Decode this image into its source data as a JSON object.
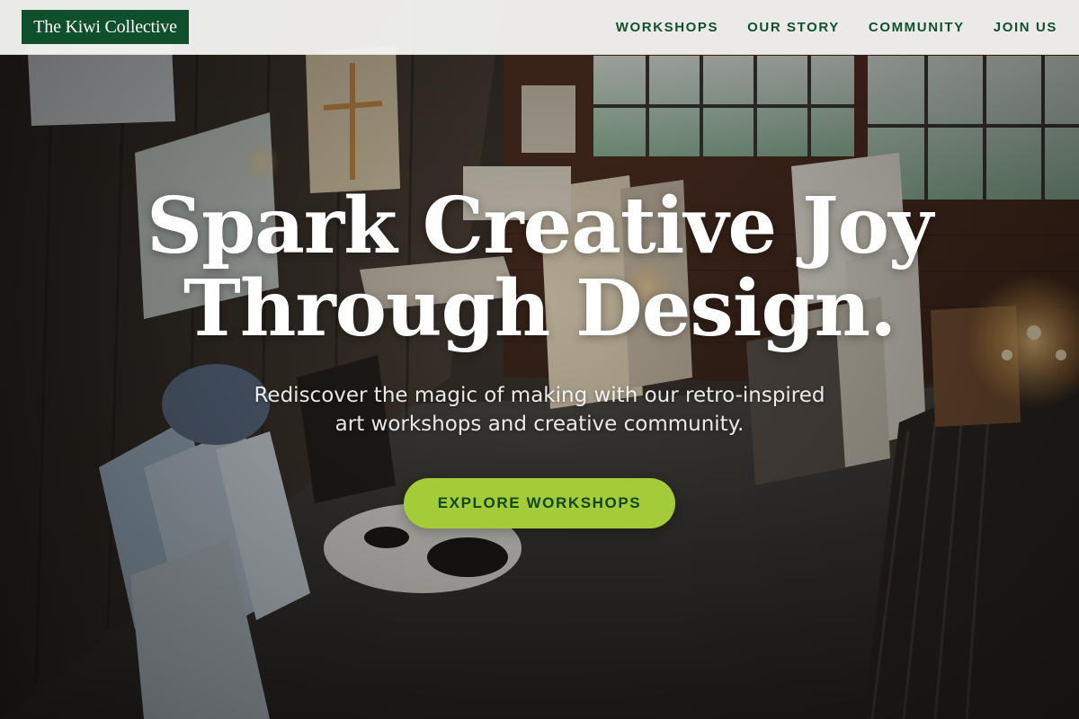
{
  "header": {
    "logo_text": "The Kiwi Collective",
    "nav": [
      {
        "label": "WORKSHOPS"
      },
      {
        "label": "OUR STORY"
      },
      {
        "label": "COMMUNITY"
      },
      {
        "label": "JOIN US"
      }
    ]
  },
  "hero": {
    "title_line1": "Spark Creative Joy",
    "title_line2": "Through Design.",
    "subtitle_line1": "Rediscover the magic of making with our retro-inspired",
    "subtitle_line2": "art workshops and creative community.",
    "cta_label": "EXPLORE WORKSHOPS",
    "background_image": "art-studio-photo"
  },
  "colors": {
    "brand_green": "#0f4f2b",
    "nav_text": "#11502c",
    "cta_background": "#a4cc38",
    "cta_text": "#12461f",
    "header_background": "#f5f5f3",
    "hero_text": "#ffffff"
  }
}
